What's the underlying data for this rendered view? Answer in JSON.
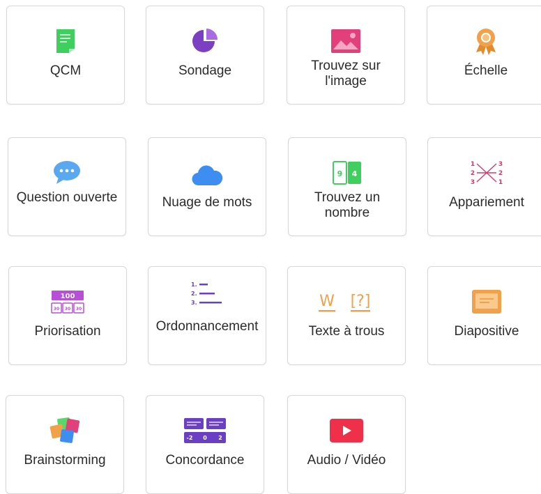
{
  "cards": [
    {
      "label": "QCM",
      "icon": "document-icon",
      "color": "#3ecf5e"
    },
    {
      "label": "Sondage",
      "icon": "pie-chart-icon",
      "color": "#7b3fc4"
    },
    {
      "label": "Trouvez sur l'image",
      "icon": "image-icon",
      "color": "#e2407a"
    },
    {
      "label": "Échelle",
      "icon": "award-ribbon-icon",
      "color": "#f0a14a"
    },
    {
      "label": "Question ouverte",
      "icon": "speech-bubble-icon",
      "color": "#5aa9f0"
    },
    {
      "label": "Nuage de mots",
      "icon": "cloud-icon",
      "color": "#3d8ef0"
    },
    {
      "label": "Trouvez un nombre",
      "icon": "number-cards-icon",
      "color": "#3ecf5e",
      "digits": [
        "9",
        "4"
      ]
    },
    {
      "label": "Appariement",
      "icon": "matching-icon",
      "color": "#d43b6b",
      "digits": [
        "1",
        "2",
        "3",
        "3",
        "2",
        "1"
      ]
    },
    {
      "label": "Priorisation",
      "icon": "prioritization-icon",
      "color": "#b84fd8",
      "digits": [
        "100",
        "30",
        "30",
        "30"
      ]
    },
    {
      "label": "Ordonnancement",
      "icon": "ordered-list-icon",
      "color": "#6b3fc4",
      "digits": [
        "1.",
        "2.",
        "3."
      ]
    },
    {
      "label": "Texte à trous",
      "icon": "fill-blank-icon",
      "color": "#f0a14a",
      "glyphs": [
        "W",
        "[?]"
      ]
    },
    {
      "label": "Diapositive",
      "icon": "slide-icon",
      "color": "#f0a14a"
    },
    {
      "label": "Brainstorming",
      "icon": "sticky-notes-icon",
      "color": "#e2407a"
    },
    {
      "label": "Concordance",
      "icon": "scale-match-icon",
      "color": "#6b3fc4",
      "digits": [
        "-2",
        "0",
        "2"
      ]
    },
    {
      "label": "Audio / Vidéo",
      "icon": "play-video-icon",
      "color": "#f0304a"
    }
  ]
}
